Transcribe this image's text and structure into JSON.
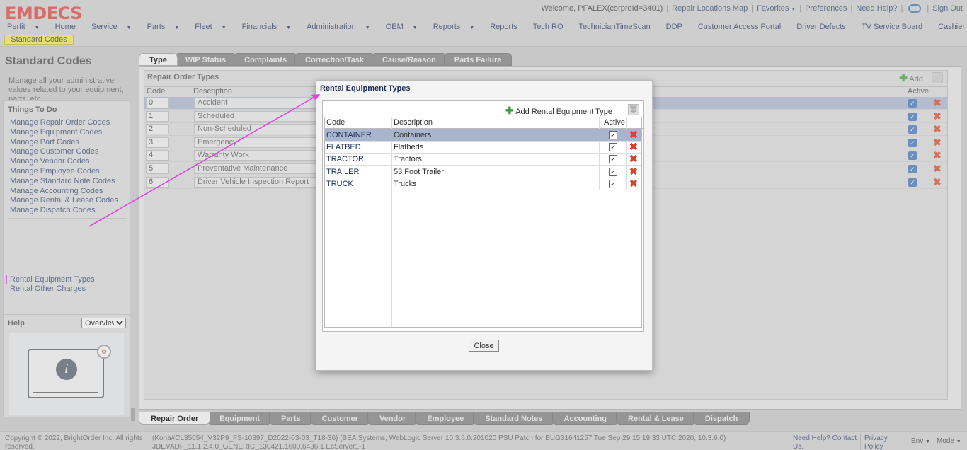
{
  "header": {
    "logo": "EMDECS",
    "welcome": "Welcome, PFALEX(corproId=3401)",
    "links": [
      "Repair Locations Map",
      "Favorites",
      "Preferences",
      "Need Help?",
      "Sign Out"
    ],
    "menu": [
      {
        "label": "Perfit",
        "dropdown": true
      },
      {
        "label": "Home",
        "dropdown": false
      },
      {
        "label": "Service",
        "dropdown": true
      },
      {
        "label": "Parts",
        "dropdown": true
      },
      {
        "label": "Fleet",
        "dropdown": true
      },
      {
        "label": "Financials",
        "dropdown": true
      },
      {
        "label": "Administration",
        "dropdown": true
      },
      {
        "label": "OEM",
        "dropdown": true
      },
      {
        "label": "Reports",
        "dropdown": true
      },
      {
        "label": "Reports",
        "dropdown": false
      },
      {
        "label": "Tech RO",
        "dropdown": false
      },
      {
        "label": "TechnicianTimeScan",
        "dropdown": false
      },
      {
        "label": "DDP",
        "dropdown": false
      },
      {
        "label": "Customer Access Portal",
        "dropdown": false
      },
      {
        "label": "Driver Defects",
        "dropdown": false
      },
      {
        "label": "TV Service Board",
        "dropdown": false
      },
      {
        "label": "Cashier Shift",
        "dropdown": false
      }
    ],
    "crumb_tab": "Standard Codes"
  },
  "left": {
    "title": "Standard Codes",
    "description": "Manage all your administrative values related to your equipment, parts, etc.",
    "things_title": "Things To Do",
    "things": [
      "Manage Repair Order Codes",
      "Manage Equipment Codes",
      "Manage Part Codes",
      "Manage Customer Codes",
      "Manage Vendor Codes",
      "Manage Employee Codes",
      "Manage Standard Note Codes",
      "Manage Accounting Codes",
      "Manage Rental & Lease Codes",
      "Manage Dispatch Codes"
    ],
    "rental_links": [
      "Rental Equipment Types",
      "Rental Other Charges"
    ],
    "help_title": "Help",
    "help_select": "Overview",
    "video_info_glyph": "i"
  },
  "main": {
    "tabs": [
      "Type",
      "WIP Status",
      "Complaints",
      "Correction/Task",
      "Cause/Reason",
      "Parts Failure"
    ],
    "active_tab": 0,
    "section_title": "Repair Order Types",
    "add_label": "Add",
    "columns": {
      "code": "Code",
      "description": "Description",
      "active": "Active"
    },
    "rows": [
      {
        "code": "0",
        "description": "Accident"
      },
      {
        "code": "1",
        "description": "Scheduled"
      },
      {
        "code": "2",
        "description": "Non-Scheduled"
      },
      {
        "code": "3",
        "description": "Emergency"
      },
      {
        "code": "4",
        "description": "Warranty Work"
      },
      {
        "code": "5",
        "description": "Preventative Maintenance"
      },
      {
        "code": "6",
        "description": "Driver Vehicle Inspection Report"
      }
    ],
    "bottom_tabs": [
      "Repair Order",
      "Equipment",
      "Parts",
      "Customer",
      "Vendor",
      "Employee",
      "Standard Notes",
      "Accounting",
      "Rental & Lease",
      "Dispatch"
    ]
  },
  "dialog": {
    "title": "Rental Equipment Types",
    "add_label": "Add Rental Equipment Type",
    "columns": {
      "code": "Code",
      "description": "Description",
      "active": "Active"
    },
    "rows": [
      {
        "code": "CONTAINER",
        "description": "Containers"
      },
      {
        "code": "FLATBED",
        "description": "Flatbeds"
      },
      {
        "code": "TRACTOR",
        "description": "Tractors"
      },
      {
        "code": "TRAILER",
        "description": "53 Foot Trailer"
      },
      {
        "code": "TRUCK",
        "description": "Trucks"
      }
    ],
    "close_label": "Close"
  },
  "footer": {
    "copyright": "Copyright © 2022, BrightOrder Inc. All rights reserved.",
    "version": "(Kona#CL35054_V32P9_FS-10397_D2022-03-03_T18-36) (BEA Systems, WebLogic Server 10.3.6.0.201020 PSU Patch for BUG31641257 Tue Sep 29 15:19:33 UTC 2020, 10.3.6.0) JDEVADF_11.1.2.4.0_GENERIC_130421.1600.6436.1 EcServer1-1",
    "need_help": "Need Help? Contact Us.",
    "privacy": "Privacy Policy",
    "env": "Env",
    "mode": "Mode"
  },
  "colors": {
    "accent_highlight": "#e040e0",
    "brand_red": "#e03a3a",
    "delete_red": "#d6442a",
    "add_green": "#3a9a3a"
  }
}
